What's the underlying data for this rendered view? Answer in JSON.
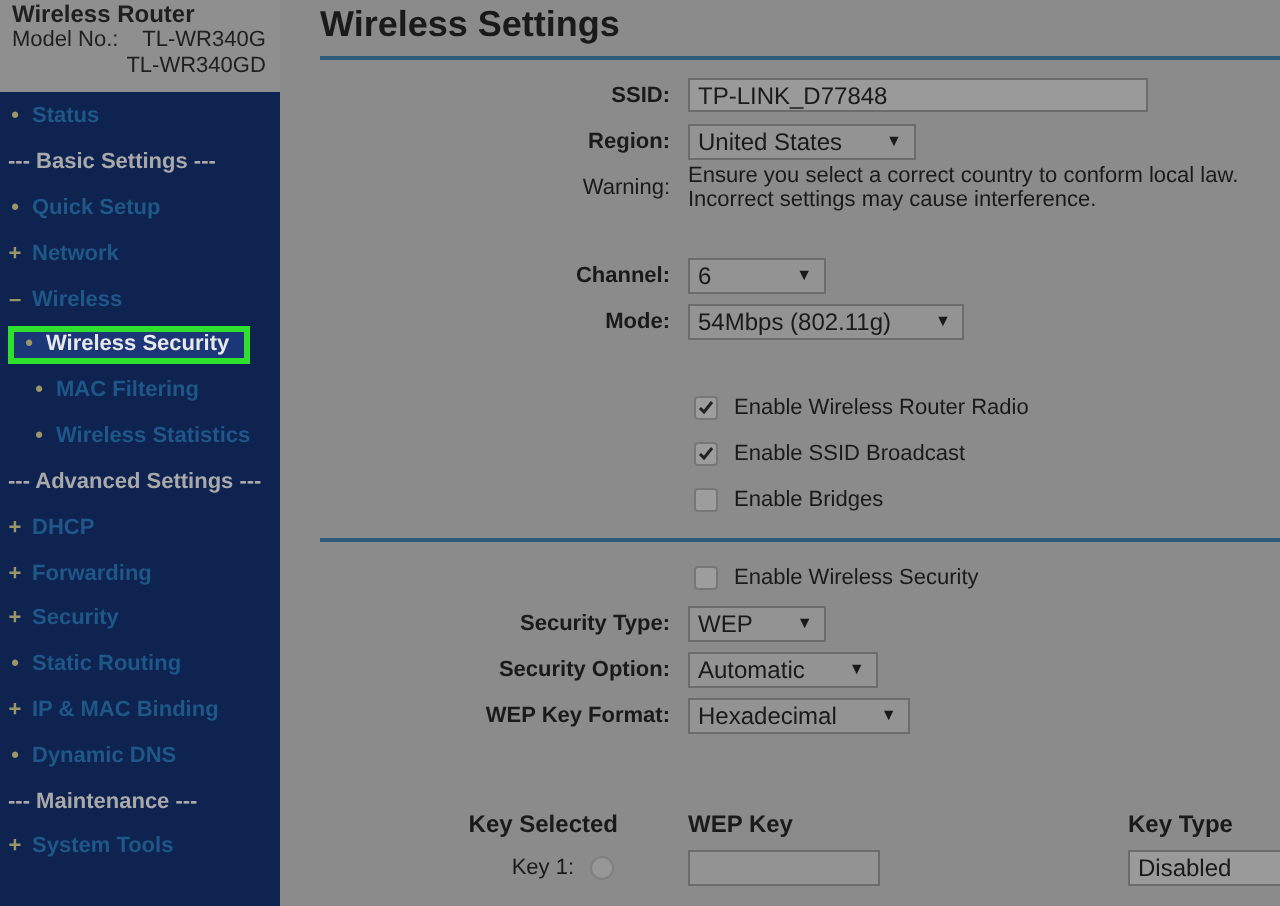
{
  "header": {
    "product": "Wireless Router",
    "model_label": "Model No.:",
    "models": [
      "TL-WR340G",
      "TL-WR340GD"
    ]
  },
  "sidebar": {
    "items": [
      {
        "kind": "link",
        "marker": "•",
        "label": "Status",
        "selected": false
      },
      {
        "kind": "section",
        "label": "--- Basic Settings ---"
      },
      {
        "kind": "link",
        "marker": "•",
        "label": "Quick Setup",
        "selected": false
      },
      {
        "kind": "link",
        "marker": "+",
        "label": "Network",
        "selected": false
      },
      {
        "kind": "link",
        "marker": "–",
        "label": "Wireless",
        "selected": false,
        "children": [
          {
            "kind": "link",
            "marker": "•",
            "label": "Wireless Security",
            "selected": true
          },
          {
            "kind": "link",
            "marker": "•",
            "label": "MAC Filtering",
            "selected": false
          },
          {
            "kind": "link",
            "marker": "•",
            "label": "Wireless Statistics",
            "selected": false
          }
        ]
      },
      {
        "kind": "section",
        "label": "--- Advanced Settings ---"
      },
      {
        "kind": "link",
        "marker": "+",
        "label": "DHCP",
        "selected": false
      },
      {
        "kind": "link",
        "marker": "+",
        "label": "Forwarding",
        "selected": false
      },
      {
        "kind": "link",
        "marker": "+",
        "label": "Security",
        "selected": false
      },
      {
        "kind": "link",
        "marker": "•",
        "label": "Static Routing",
        "selected": false
      },
      {
        "kind": "link",
        "marker": "+",
        "label": "IP & MAC Binding",
        "selected": false
      },
      {
        "kind": "link",
        "marker": "•",
        "label": "Dynamic DNS",
        "selected": false
      },
      {
        "kind": "section",
        "label": "--- Maintenance ---"
      },
      {
        "kind": "link",
        "marker": "+",
        "label": "System Tools",
        "selected": false
      }
    ]
  },
  "main": {
    "title": "Wireless Settings",
    "sections": [
      {
        "rows": [
          {
            "kind": "text",
            "label": "SSID:",
            "value": "TP-LINK_D77848"
          },
          {
            "kind": "select",
            "label": "Region:",
            "value": "United States",
            "arrow": "▼"
          },
          {
            "kind": "note",
            "label": "Warning:",
            "lines": [
              "Ensure you select a correct country to conform local law.",
              "Incorrect settings may cause interference."
            ]
          },
          {
            "kind": "gap"
          },
          {
            "kind": "select",
            "label": "Channel:",
            "value": "6",
            "arrow": "▼"
          },
          {
            "kind": "select",
            "label": "Mode:",
            "value": "54Mbps (802.11g)",
            "arrow": "▼"
          },
          {
            "kind": "gap"
          },
          {
            "kind": "checkbox",
            "label": "Enable Wireless Router Radio",
            "checked": true
          },
          {
            "kind": "checkbox",
            "label": "Enable SSID Broadcast",
            "checked": true
          },
          {
            "kind": "checkbox",
            "label": "Enable Bridges",
            "checked": false
          }
        ]
      },
      {
        "rows": [
          {
            "kind": "checkbox",
            "label": "Enable Wireless Security",
            "checked": false
          },
          {
            "kind": "select",
            "label": "Security Type:",
            "value": "WEP",
            "arrow": "▼"
          },
          {
            "kind": "select",
            "label": "Security Option:",
            "value": "Automatic",
            "arrow": "▼"
          },
          {
            "kind": "select",
            "label": "WEP Key Format:",
            "value": "Hexadecimal",
            "arrow": "▼"
          },
          {
            "kind": "gap"
          }
        ]
      }
    ],
    "key_table": {
      "columns": [
        "Key Selected",
        "WEP Key",
        "Key Type"
      ],
      "rows": [
        {
          "label": "Key 1:",
          "selected": false,
          "type": "Disabled"
        }
      ]
    }
  }
}
